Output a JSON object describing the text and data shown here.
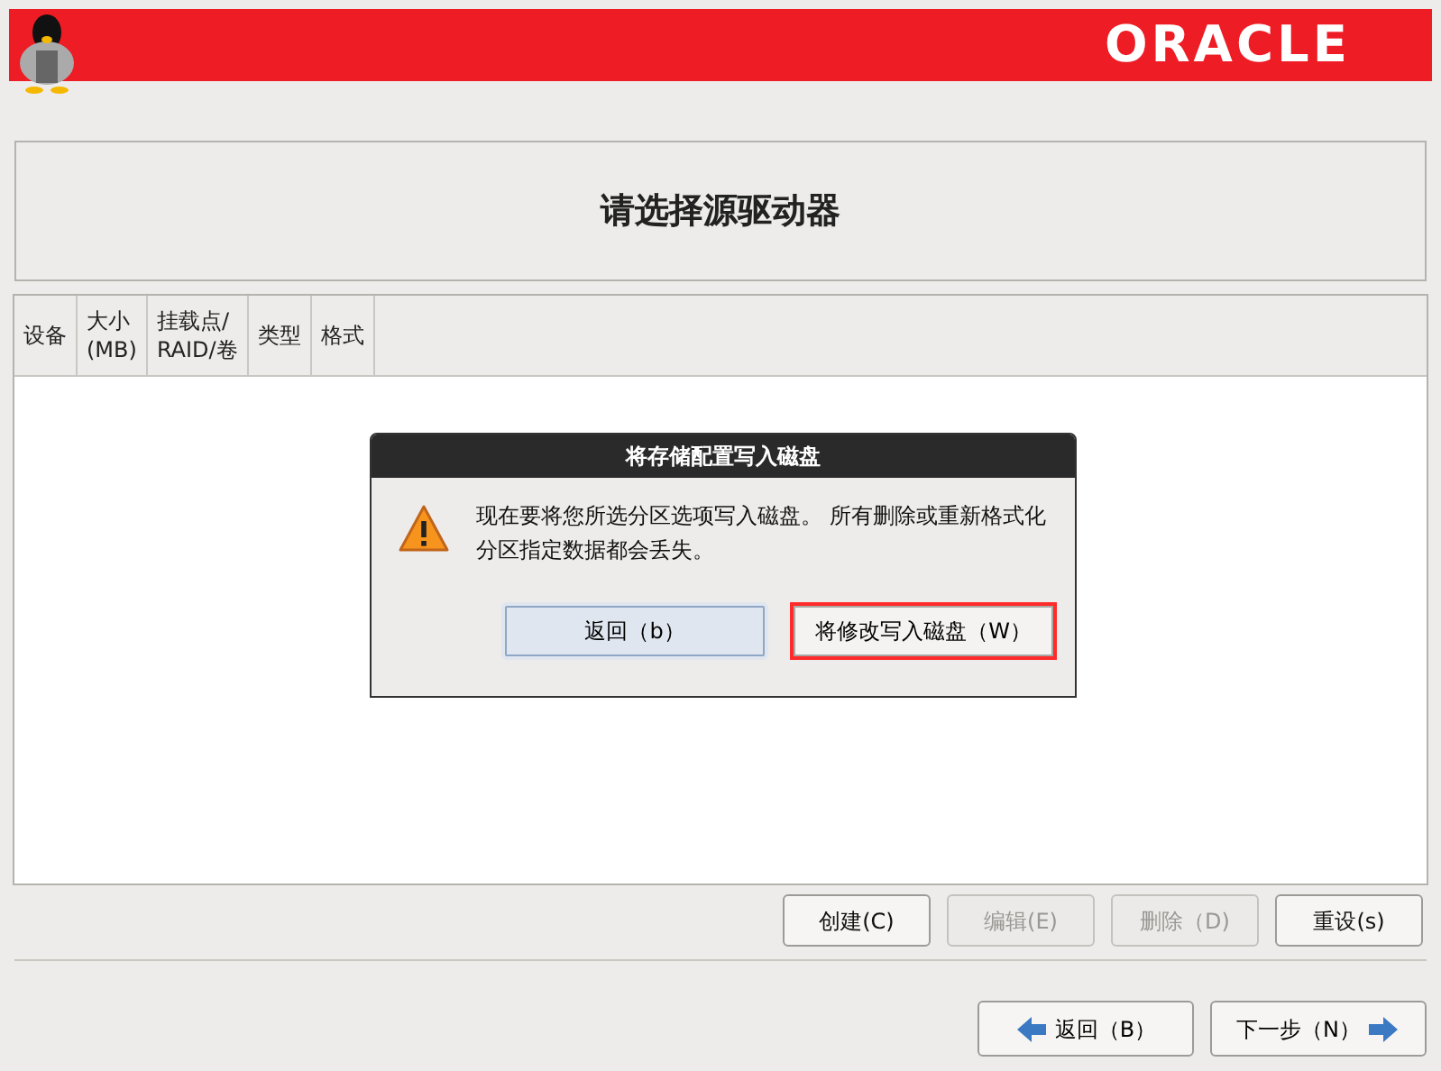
{
  "header": {
    "logo": "ORACLE"
  },
  "title": "请选择源驱动器",
  "table": {
    "columns": [
      "设备",
      "大小\n(MB)",
      "挂载点/\nRAID/卷",
      "类型",
      "格式"
    ]
  },
  "dialog": {
    "title": "将存储配置写入磁盘",
    "message": "现在要将您所选分区选项写入磁盘。 所有删除或重新格式化分区指定数据都会丢失。",
    "buttons": [
      {
        "label": "返回（b）",
        "highlighted": false
      },
      {
        "label": "将修改写入磁盘（W）",
        "highlighted": true
      }
    ]
  },
  "actions": [
    {
      "label": "创建(C)",
      "disabled": false
    },
    {
      "label": "编辑(E)",
      "disabled": true
    },
    {
      "label": "删除（D)",
      "disabled": true
    },
    {
      "label": "重设(s)",
      "disabled": false
    }
  ],
  "nav": [
    {
      "label": "返回（B）",
      "kind": "back"
    },
    {
      "label": "下一步（N）",
      "kind": "next"
    }
  ]
}
